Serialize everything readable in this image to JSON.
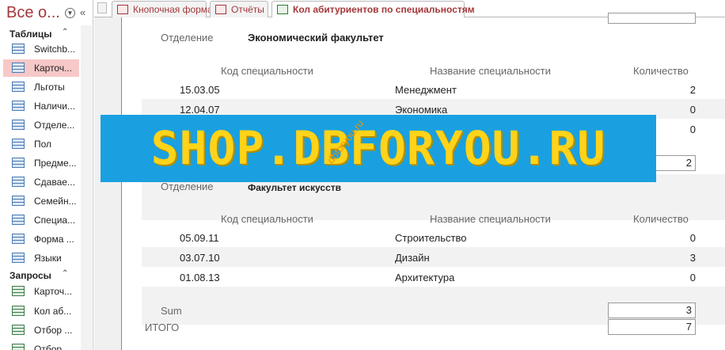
{
  "nav": {
    "title": "Все о...",
    "groups": [
      {
        "label": "Таблицы"
      },
      {
        "label": "Запросы"
      }
    ],
    "tables": [
      {
        "label": "Switchb..."
      },
      {
        "label": "Карточ..."
      },
      {
        "label": "Льготы"
      },
      {
        "label": "Наличи..."
      },
      {
        "label": "Отделе..."
      },
      {
        "label": "Пол"
      },
      {
        "label": "Предме..."
      },
      {
        "label": "Сдавае..."
      },
      {
        "label": "Семейн..."
      },
      {
        "label": "Специа..."
      },
      {
        "label": "Форма ..."
      },
      {
        "label": "Языки"
      }
    ],
    "queries": [
      {
        "label": "Карточ..."
      },
      {
        "label": "Кол аб..."
      },
      {
        "label": "Отбор ..."
      },
      {
        "label": "Отбор ..."
      }
    ]
  },
  "tabs": [
    {
      "label": "Кнопочная форма"
    },
    {
      "label": "Отчёты"
    },
    {
      "label": "Кол абитуриентов по специальностям"
    }
  ],
  "report": {
    "dept_label": "Отделение",
    "columns": {
      "code": "Код специальности",
      "name": "Название специальности",
      "count": "Количество"
    },
    "groups": [
      {
        "dept": "Экономический факультет",
        "rows": [
          {
            "code": "15.03.05",
            "name": "Менеджмент",
            "count": "2"
          },
          {
            "code": "12.04.07",
            "name": "Экономика",
            "count": "0"
          },
          {
            "code": "",
            "name": "",
            "count": "0"
          }
        ],
        "sum": "2"
      },
      {
        "dept": "Факультет искусств",
        "rows": [
          {
            "code": "05.09.11",
            "name": "Строительство",
            "count": "0"
          },
          {
            "code": "03.07.10",
            "name": "Дизайн",
            "count": "3"
          },
          {
            "code": "01.08.13",
            "name": "Архитектура",
            "count": "0"
          }
        ],
        "sum": "3"
      }
    ],
    "sum_label": "Sum",
    "total_label": "ИТОГО",
    "total": "7"
  },
  "watermark": {
    "banner": "SHOP.DBFORYOU.RU",
    "diagonal": "dbforyou.ru"
  },
  "colors": {
    "accent": "#a4373a",
    "banner_bg": "#1aa0e0",
    "banner_text": "#ffd319",
    "selected": "#f7c8c8"
  }
}
